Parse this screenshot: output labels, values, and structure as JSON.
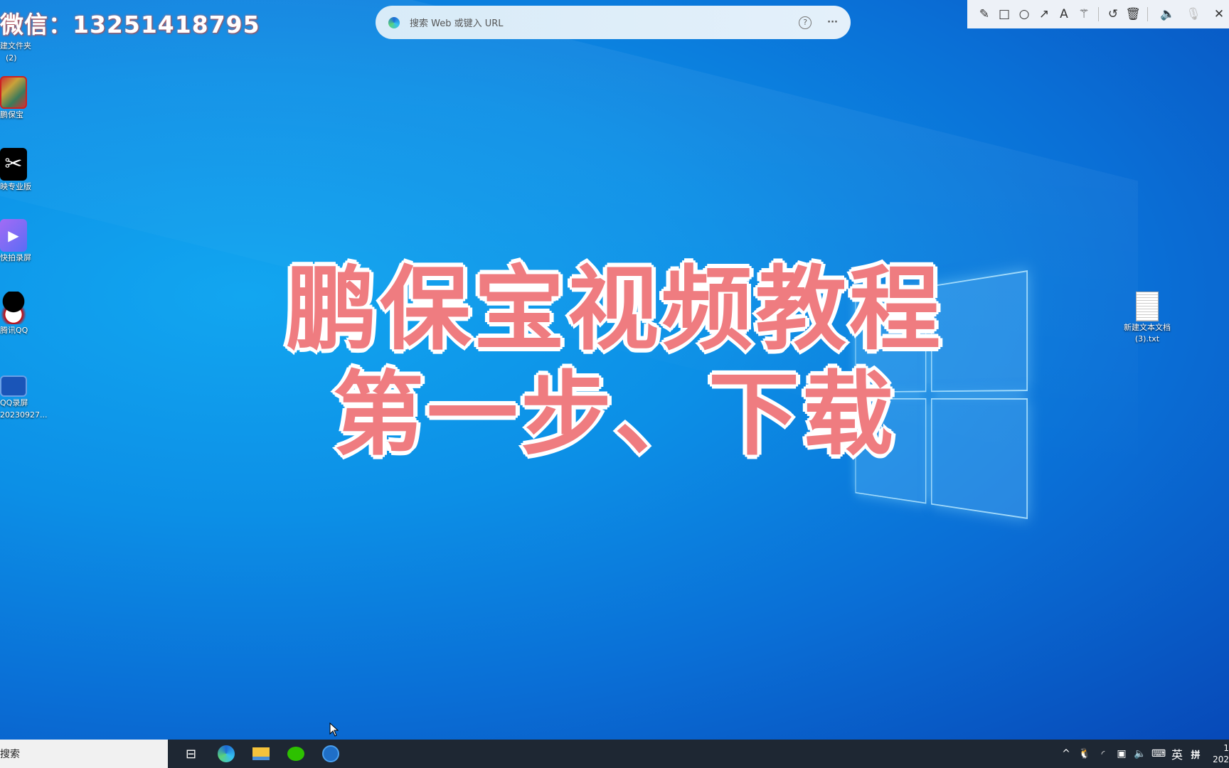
{
  "watermark": "微信：13251418795",
  "browser_bar": {
    "placeholder": "搜索 Web 或键入 URL",
    "help_icon": "?",
    "more_icon": "···"
  },
  "annotation_toolbar": {
    "tools": [
      "pencil-icon",
      "rectangle-icon",
      "circle-icon",
      "arrow-icon",
      "text-icon",
      "magic-wand-icon",
      "undo-icon",
      "trash-icon",
      "speaker-icon",
      "mic-muted-icon",
      "close-icon"
    ]
  },
  "desktop_icons": [
    {
      "label1": "建文件夹",
      "label2": "(2)"
    },
    {
      "label1": "鹏保宝",
      "label2": ""
    },
    {
      "label1": "映专业版",
      "label2": ""
    },
    {
      "label1": "快拍录屏",
      "label2": ""
    },
    {
      "label1": "腾讯QQ",
      "label2": ""
    },
    {
      "label1": "QQ录屏",
      "label2": "20230927..."
    }
  ],
  "right_file": {
    "label1": "新建文本文档",
    "label2": "(3).txt"
  },
  "title": {
    "line1": "鹏保宝视频教程",
    "line2": "第一步、下载"
  },
  "taskbar": {
    "search": "搜索",
    "ime_lang": "英",
    "ime_mode": "拼",
    "clock_time": "1",
    "clock_date": "202"
  },
  "colors": {
    "title": "#ef7c80",
    "taskbar": "#1e2733",
    "toolbar": "#edf1f7"
  }
}
